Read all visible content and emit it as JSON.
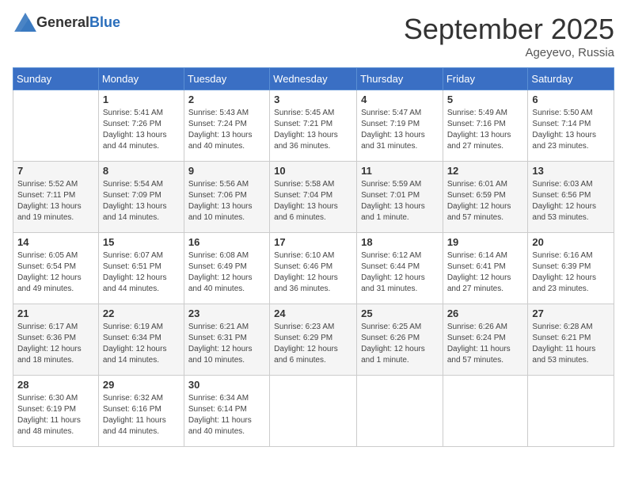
{
  "header": {
    "logo_general": "General",
    "logo_blue": "Blue",
    "month_title": "September 2025",
    "subtitle": "Ageyevo, Russia"
  },
  "days_of_week": [
    "Sunday",
    "Monday",
    "Tuesday",
    "Wednesday",
    "Thursday",
    "Friday",
    "Saturday"
  ],
  "weeks": [
    [
      {
        "day": "",
        "info": ""
      },
      {
        "day": "1",
        "info": "Sunrise: 5:41 AM\nSunset: 7:26 PM\nDaylight: 13 hours and 44 minutes."
      },
      {
        "day": "2",
        "info": "Sunrise: 5:43 AM\nSunset: 7:24 PM\nDaylight: 13 hours and 40 minutes."
      },
      {
        "day": "3",
        "info": "Sunrise: 5:45 AM\nSunset: 7:21 PM\nDaylight: 13 hours and 36 minutes."
      },
      {
        "day": "4",
        "info": "Sunrise: 5:47 AM\nSunset: 7:19 PM\nDaylight: 13 hours and 31 minutes."
      },
      {
        "day": "5",
        "info": "Sunrise: 5:49 AM\nSunset: 7:16 PM\nDaylight: 13 hours and 27 minutes."
      },
      {
        "day": "6",
        "info": "Sunrise: 5:50 AM\nSunset: 7:14 PM\nDaylight: 13 hours and 23 minutes."
      }
    ],
    [
      {
        "day": "7",
        "info": "Sunrise: 5:52 AM\nSunset: 7:11 PM\nDaylight: 13 hours and 19 minutes."
      },
      {
        "day": "8",
        "info": "Sunrise: 5:54 AM\nSunset: 7:09 PM\nDaylight: 13 hours and 14 minutes."
      },
      {
        "day": "9",
        "info": "Sunrise: 5:56 AM\nSunset: 7:06 PM\nDaylight: 13 hours and 10 minutes."
      },
      {
        "day": "10",
        "info": "Sunrise: 5:58 AM\nSunset: 7:04 PM\nDaylight: 13 hours and 6 minutes."
      },
      {
        "day": "11",
        "info": "Sunrise: 5:59 AM\nSunset: 7:01 PM\nDaylight: 13 hours and 1 minute."
      },
      {
        "day": "12",
        "info": "Sunrise: 6:01 AM\nSunset: 6:59 PM\nDaylight: 12 hours and 57 minutes."
      },
      {
        "day": "13",
        "info": "Sunrise: 6:03 AM\nSunset: 6:56 PM\nDaylight: 12 hours and 53 minutes."
      }
    ],
    [
      {
        "day": "14",
        "info": "Sunrise: 6:05 AM\nSunset: 6:54 PM\nDaylight: 12 hours and 49 minutes."
      },
      {
        "day": "15",
        "info": "Sunrise: 6:07 AM\nSunset: 6:51 PM\nDaylight: 12 hours and 44 minutes."
      },
      {
        "day": "16",
        "info": "Sunrise: 6:08 AM\nSunset: 6:49 PM\nDaylight: 12 hours and 40 minutes."
      },
      {
        "day": "17",
        "info": "Sunrise: 6:10 AM\nSunset: 6:46 PM\nDaylight: 12 hours and 36 minutes."
      },
      {
        "day": "18",
        "info": "Sunrise: 6:12 AM\nSunset: 6:44 PM\nDaylight: 12 hours and 31 minutes."
      },
      {
        "day": "19",
        "info": "Sunrise: 6:14 AM\nSunset: 6:41 PM\nDaylight: 12 hours and 27 minutes."
      },
      {
        "day": "20",
        "info": "Sunrise: 6:16 AM\nSunset: 6:39 PM\nDaylight: 12 hours and 23 minutes."
      }
    ],
    [
      {
        "day": "21",
        "info": "Sunrise: 6:17 AM\nSunset: 6:36 PM\nDaylight: 12 hours and 18 minutes."
      },
      {
        "day": "22",
        "info": "Sunrise: 6:19 AM\nSunset: 6:34 PM\nDaylight: 12 hours and 14 minutes."
      },
      {
        "day": "23",
        "info": "Sunrise: 6:21 AM\nSunset: 6:31 PM\nDaylight: 12 hours and 10 minutes."
      },
      {
        "day": "24",
        "info": "Sunrise: 6:23 AM\nSunset: 6:29 PM\nDaylight: 12 hours and 6 minutes."
      },
      {
        "day": "25",
        "info": "Sunrise: 6:25 AM\nSunset: 6:26 PM\nDaylight: 12 hours and 1 minute."
      },
      {
        "day": "26",
        "info": "Sunrise: 6:26 AM\nSunset: 6:24 PM\nDaylight: 11 hours and 57 minutes."
      },
      {
        "day": "27",
        "info": "Sunrise: 6:28 AM\nSunset: 6:21 PM\nDaylight: 11 hours and 53 minutes."
      }
    ],
    [
      {
        "day": "28",
        "info": "Sunrise: 6:30 AM\nSunset: 6:19 PM\nDaylight: 11 hours and 48 minutes."
      },
      {
        "day": "29",
        "info": "Sunrise: 6:32 AM\nSunset: 6:16 PM\nDaylight: 11 hours and 44 minutes."
      },
      {
        "day": "30",
        "info": "Sunrise: 6:34 AM\nSunset: 6:14 PM\nDaylight: 11 hours and 40 minutes."
      },
      {
        "day": "",
        "info": ""
      },
      {
        "day": "",
        "info": ""
      },
      {
        "day": "",
        "info": ""
      },
      {
        "day": "",
        "info": ""
      }
    ]
  ]
}
